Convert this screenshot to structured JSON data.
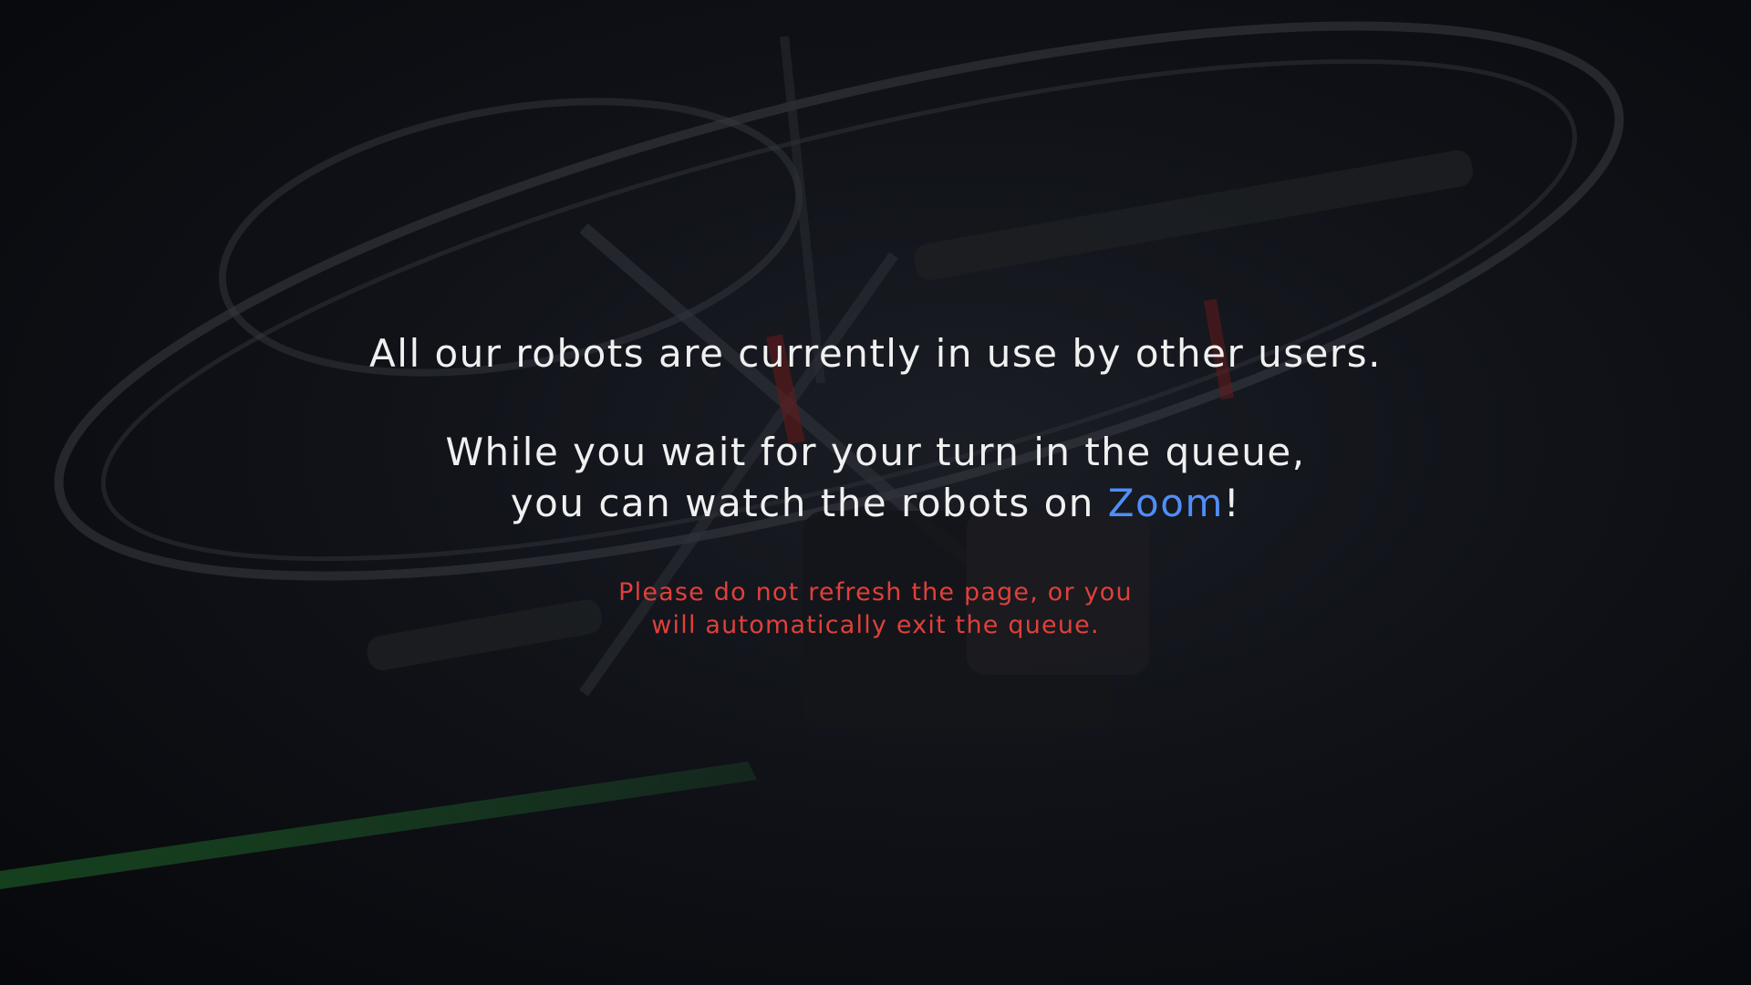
{
  "message": {
    "line1": "All our robots are currently in use by other users.",
    "line2": "While you wait for your turn in the queue,",
    "line3_prefix": "you can watch the robots on ",
    "zoom_link": "Zoom",
    "line3_suffix": "!"
  },
  "warning": {
    "line1": "Please do not refresh the page, or you",
    "line2": "will automatically exit the queue."
  },
  "colors": {
    "background": "#0a0c10",
    "text": "#f0f0f0",
    "link": "#4f8ef7",
    "warning": "#e0403a"
  }
}
